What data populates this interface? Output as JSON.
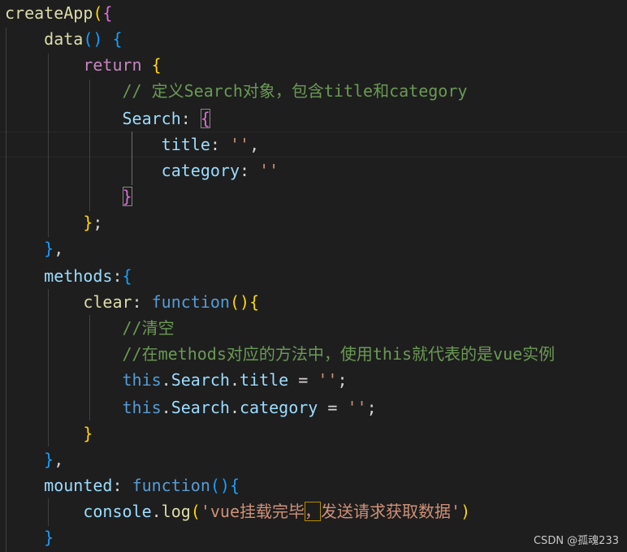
{
  "code": {
    "l1": {
      "createApp": "createApp",
      "paren": "(",
      "brace": "{"
    },
    "l2": {
      "data": "data",
      "parens": "()",
      "brace": "{"
    },
    "l3": {
      "return": "return",
      "brace": "{"
    },
    "l4": {
      "comment": "// 定义Search对象，包含title和category"
    },
    "l5": {
      "search": "Search",
      "colon": ":",
      "brace": "{"
    },
    "l6": {
      "title": "title",
      "colon": ":",
      "str": "''",
      "comma": ","
    },
    "l7": {
      "category": "category",
      "colon": ":",
      "str": "''"
    },
    "l8": {
      "brace": "}"
    },
    "l9": {
      "brace": "}",
      "semi": ";"
    },
    "l10": {
      "brace": "}",
      "comma": ","
    },
    "l11": {
      "methods": "methods",
      "colon": ":",
      "brace": "{"
    },
    "l12": {
      "clear": "clear",
      "colon": ":",
      "function": "function",
      "parens": "()",
      "brace": "{"
    },
    "l13": {
      "comment": "//清空"
    },
    "l14": {
      "comment": "//在methods对应的方法中，使用this就代表的是vue实例"
    },
    "l15": {
      "this": "this",
      "dot1": ".",
      "search": "Search",
      "dot2": ".",
      "title": "title",
      "assign": " = ",
      "str": "''",
      "semi": ";"
    },
    "l16": {
      "this": "this",
      "dot1": ".",
      "search": "Search",
      "dot2": ".",
      "category": "category",
      "assign": " = ",
      "str": "''",
      "semi": ";"
    },
    "l17": {
      "brace": "}"
    },
    "l18": {
      "brace": "}",
      "comma": ","
    },
    "l19": {
      "mounted": "mounted",
      "colon": ":",
      "function": "function",
      "parens": "()",
      "brace": "{"
    },
    "l20": {
      "console": "console",
      "dot": ".",
      "log": "log",
      "paren_open": "(",
      "str1": "'vue挂载完毕",
      "sel": "，",
      "str2": "发送请求获取数据'",
      "paren_close": ")"
    },
    "l21": {
      "brace": "}"
    }
  },
  "watermark": "CSDN @孤魂233",
  "colors": {
    "background": "#1e1e1e",
    "keyword": "#c586c0",
    "storage": "#569cd6",
    "function": "#dcdcaa",
    "property": "#9cdcfe",
    "string": "#ce9178",
    "comment": "#6a9955",
    "bracket_gold": "#ffd700",
    "bracket_orchid": "#da70d6",
    "bracket_blue": "#179fff"
  }
}
